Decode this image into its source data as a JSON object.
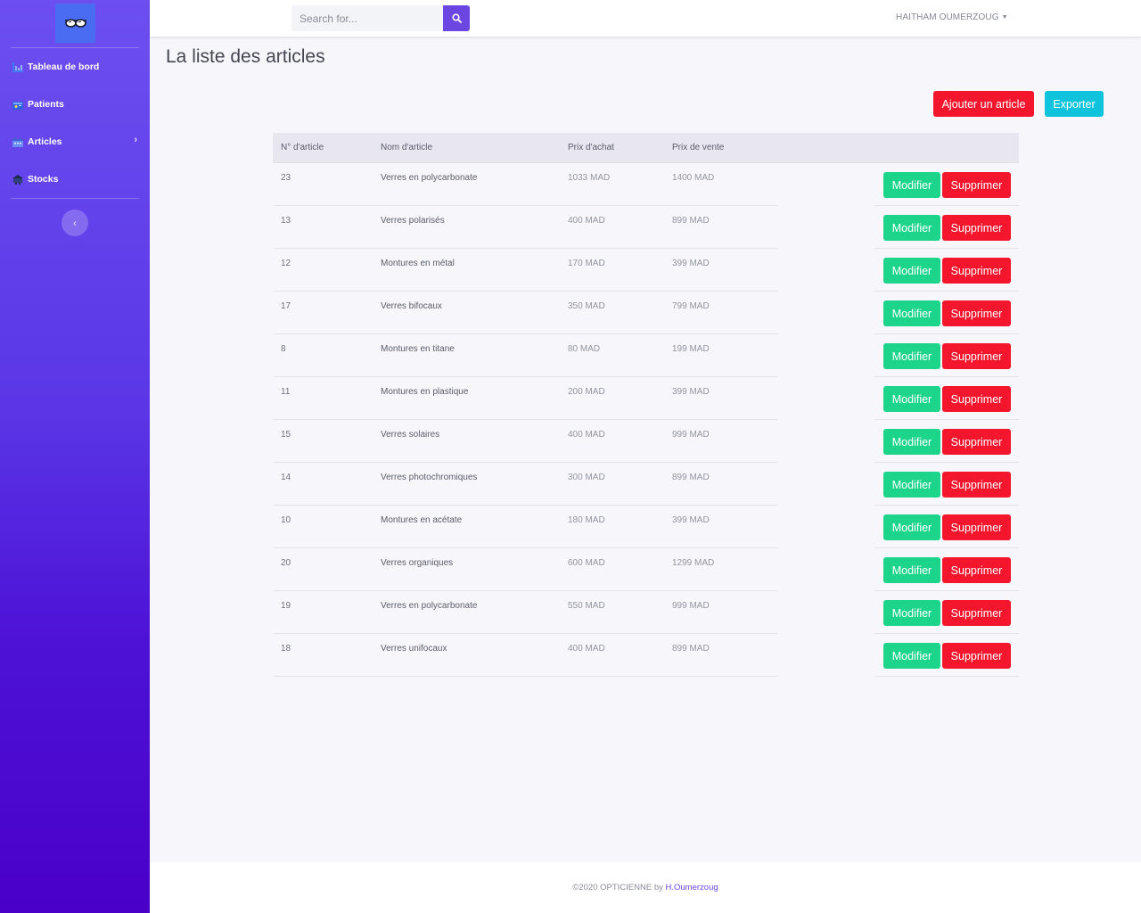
{
  "sidebar": {
    "items": [
      {
        "label": "Tableau de bord",
        "icon": "chart-bar-icon"
      },
      {
        "label": "Patients",
        "icon": "user-card-icon"
      },
      {
        "label": "Articles",
        "icon": "calendar-icon"
      },
      {
        "label": "Stocks",
        "icon": "warehouse-icon"
      }
    ],
    "toggle_icon": "chevron-left-icon"
  },
  "topbar": {
    "search_placeholder": "Search for...",
    "user_name": "HAITHAM OUMERZOUG"
  },
  "main": {
    "title": "La liste des articles",
    "add_button": "Ajouter un article",
    "export_button": "Exporter",
    "table": {
      "headers": [
        "N° d'article",
        "Nom d'article",
        "Prix d'achat",
        "Prix de vente"
      ],
      "rows": [
        {
          "id": "23",
          "name": "Verres en polycarbonate",
          "buy": "1033 MAD",
          "sell": "1400 MAD"
        },
        {
          "id": "13",
          "name": "Verres polarisés",
          "buy": "400 MAD",
          "sell": "899 MAD"
        },
        {
          "id": "12",
          "name": "Montures en métal",
          "buy": "170 MAD",
          "sell": "399 MAD"
        },
        {
          "id": "17",
          "name": "Verres bifocaux",
          "buy": "350 MAD",
          "sell": "799 MAD"
        },
        {
          "id": "8",
          "name": "Montures en titane",
          "buy": "80 MAD",
          "sell": "199 MAD"
        },
        {
          "id": "11",
          "name": "Montures en plastique",
          "buy": "200 MAD",
          "sell": "399 MAD"
        },
        {
          "id": "15",
          "name": "Verres solaires",
          "buy": "400 MAD",
          "sell": "999 MAD"
        },
        {
          "id": "14",
          "name": "Verres photochromiques",
          "buy": "300 MAD",
          "sell": "899 MAD"
        },
        {
          "id": "10",
          "name": "Montures en acétate",
          "buy": "180 MAD",
          "sell": "399 MAD"
        },
        {
          "id": "20",
          "name": "Verres organiques",
          "buy": "600 MAD",
          "sell": "1299 MAD"
        },
        {
          "id": "19",
          "name": "Verres en polycarbonate",
          "buy": "550 MAD",
          "sell": "999 MAD"
        },
        {
          "id": "18",
          "name": "Verres unifocaux",
          "buy": "400 MAD",
          "sell": "899 MAD"
        }
      ],
      "edit_label": "Modifier",
      "delete_label": "Supprimer"
    }
  },
  "footer": {
    "text": "©2020 OPTICIENNE by ",
    "link": "H.Oumerzoug"
  },
  "colors": {
    "accent": "#6c46e3",
    "success": "#1cd48a",
    "danger": "#f3162d",
    "info": "#0fc3dc"
  }
}
